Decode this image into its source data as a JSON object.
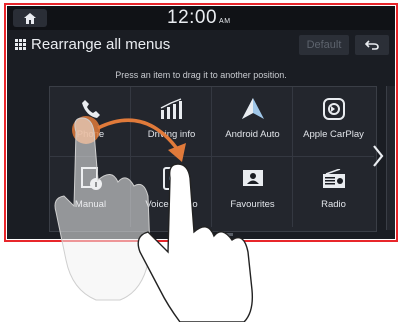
{
  "status": {
    "time": "12:00",
    "ampm": "AM"
  },
  "header": {
    "title": "Rearrange all menus",
    "default_label": "Default"
  },
  "hint": "Press an item to drag it to another position.",
  "menu_items": [
    {
      "label": "Phone",
      "icon": "phone-icon"
    },
    {
      "label": "Driving info",
      "icon": "driving-info-icon"
    },
    {
      "label": "Android Auto",
      "icon": "android-auto-icon"
    },
    {
      "label": "Apple CarPlay",
      "icon": "apple-carplay-icon"
    },
    {
      "label": "Manual",
      "icon": "manual-icon"
    },
    {
      "label": "Voice memo",
      "icon": "voice-memo-icon"
    },
    {
      "label": "Favourites",
      "icon": "favourites-icon"
    },
    {
      "label": "Radio",
      "icon": "radio-icon"
    }
  ],
  "colors": {
    "frame": "#e8262b",
    "screen": "#1a1d23",
    "drag_arrow": "#e07a3a",
    "text": "#e2e5ea"
  }
}
